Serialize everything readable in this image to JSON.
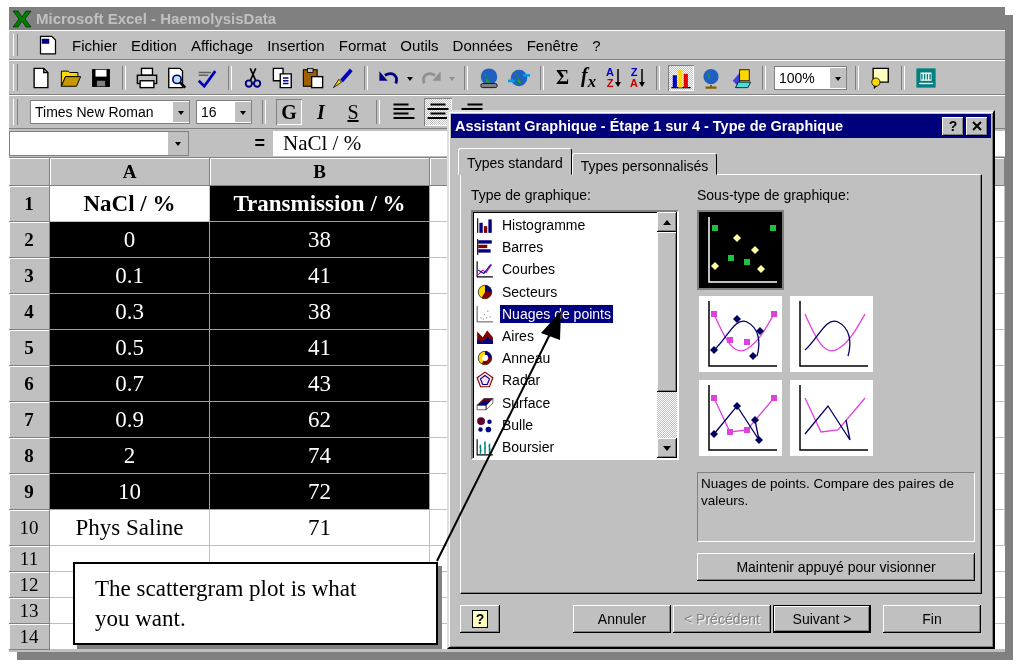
{
  "window": {
    "title": "Microsoft Excel - HaemolysisData"
  },
  "menu_bar": [
    "Fichier",
    "Edition",
    "Affichage",
    "Insertion",
    "Format",
    "Outils",
    "Données",
    "Fenêtre",
    "?"
  ],
  "standard_toolbar": {
    "sum_button": "Σ",
    "function_button": "f$_{x}$",
    "sort_ascending": [
      "A",
      "Z"
    ],
    "sort_descending": [
      "Z",
      "A"
    ],
    "zoom": "100%"
  },
  "formatting_toolbar": {
    "font": "Times New Roman",
    "size": "16",
    "bold": {
      "label": "G",
      "pressed": true
    },
    "italic": {
      "label": "I",
      "pressed": false
    },
    "underline": {
      "label": "S",
      "pressed": false
    },
    "align": [
      {
        "pressed": false
      },
      {
        "pressed": true
      },
      {
        "pressed": false
      }
    ]
  },
  "formula_bar": {
    "equals": "=",
    "content": "NaCl / %"
  },
  "sheet": {
    "columns": [
      "A",
      "B"
    ],
    "rows": [
      {
        "header": "1",
        "cells": [
          {
            "text": "NaCl / %",
            "selected": false
          },
          {
            "text": "Transmission / %",
            "selected": true
          }
        ]
      },
      {
        "header": "2",
        "cells": [
          {
            "text": "0",
            "selected": true
          },
          {
            "text": "38",
            "selected": true
          }
        ]
      },
      {
        "header": "3",
        "cells": [
          {
            "text": "0.1",
            "selected": true
          },
          {
            "text": "41",
            "selected": true
          }
        ]
      },
      {
        "header": "4",
        "cells": [
          {
            "text": "0.3",
            "selected": true
          },
          {
            "text": "38",
            "selected": true
          }
        ]
      },
      {
        "header": "5",
        "cells": [
          {
            "text": "0.5",
            "selected": true
          },
          {
            "text": "41",
            "selected": true
          }
        ]
      },
      {
        "header": "6",
        "cells": [
          {
            "text": "0.7",
            "selected": true
          },
          {
            "text": "43",
            "selected": true
          }
        ]
      },
      {
        "header": "7",
        "cells": [
          {
            "text": "0.9",
            "selected": true
          },
          {
            "text": "62",
            "selected": true
          }
        ]
      },
      {
        "header": "8",
        "cells": [
          {
            "text": "2",
            "selected": true
          },
          {
            "text": "74",
            "selected": true
          }
        ]
      },
      {
        "header": "9",
        "cells": [
          {
            "text": "10",
            "selected": true
          },
          {
            "text": "72",
            "selected": true
          }
        ]
      },
      {
        "header": "10",
        "cells": [
          {
            "text": "Phys Saline",
            "selected": false
          },
          {
            "text": "71",
            "selected": false
          }
        ]
      },
      {
        "header": "11",
        "cells": []
      },
      {
        "header": "12",
        "cells": []
      },
      {
        "header": "13",
        "cells": []
      },
      {
        "header": "14",
        "cells": []
      }
    ]
  },
  "dialog": {
    "title": "Assistant Graphique - Étape 1 sur 4 - Type de Graphique",
    "title_help": "?",
    "tabs": [
      {
        "label": "Types standard",
        "selected": true
      },
      {
        "label": "Types personnalisés",
        "selected": false
      }
    ],
    "chart_type_label": "Type de graphique:",
    "chart_types": [
      {
        "label": "Histogramme",
        "selected": false
      },
      {
        "label": "Barres",
        "selected": false
      },
      {
        "label": "Courbes",
        "selected": false
      },
      {
        "label": "Secteurs",
        "selected": false
      },
      {
        "label": "Nuages de points",
        "selected": true
      },
      {
        "label": "Aires",
        "selected": false
      },
      {
        "label": "Anneau",
        "selected": false
      },
      {
        "label": "Radar",
        "selected": false
      },
      {
        "label": "Surface",
        "selected": false
      },
      {
        "label": "Bulle",
        "selected": false
      },
      {
        "label": "Boursier",
        "selected": false
      }
    ],
    "subtype_label": "Sous-type de graphique:",
    "subtypes": [
      {
        "selected": true
      },
      {
        "selected": false
      },
      {
        "selected": false
      },
      {
        "selected": false
      },
      {
        "selected": false
      }
    ],
    "description": "Nuages de points. Compare des paires de valeurs.",
    "preview_button": "Maintenir appuyé pour visionner",
    "help_button": "?",
    "buttons": [
      {
        "label": "Annuler",
        "disabled": false,
        "default": false
      },
      {
        "label": "< Précédent",
        "disabled": true,
        "default": false
      },
      {
        "label": "Suivant >",
        "disabled": false,
        "default": true
      },
      {
        "label": "Fin",
        "disabled": false,
        "default": false
      }
    ]
  },
  "callout": {
    "text": "The scattergram plot is what you want."
  }
}
